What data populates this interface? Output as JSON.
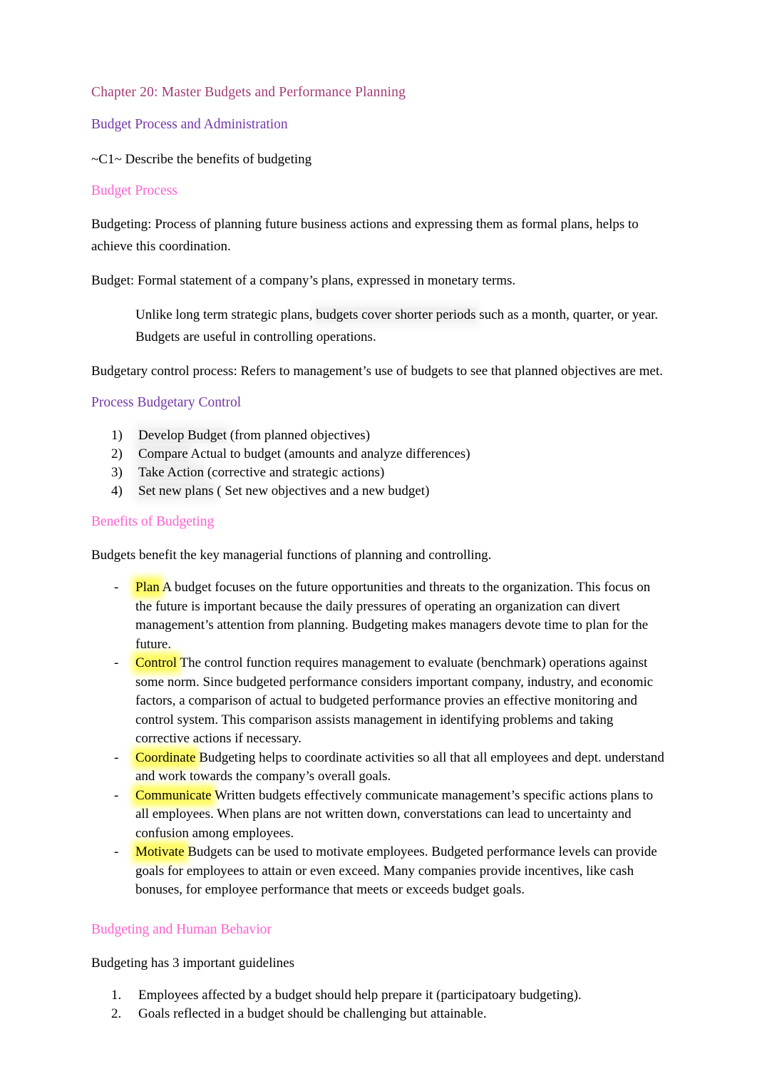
{
  "document": {
    "title": "Chapter 20: Master Budgets and Performance Planning",
    "colors": {
      "chapter_heading": "#A23A73",
      "purple_heading": "#7336A6",
      "pink_heading": "#FF5FD0",
      "body_text": "#000000",
      "highlight_yellow": "#FFFB6B",
      "highlight_gray": "#EDEDED",
      "page_background": "#FFFFFF"
    }
  },
  "sections": {
    "heading_admin": "Budget Process and Administration",
    "objective_c1": "~C1~ Describe the benefits of budgeting",
    "heading_budget_process": "Budget Process",
    "para_budgeting": "Budgeting: Process of planning future business actions and expressing them as formal plans, helps to achieve this coordination.",
    "para_budget": "Budget: Formal statement of a company’s plans, expressed in monetary terms.",
    "indent_unlike": {
      "pre": "Unlike long term strategic plans, ",
      "highlighted": "budgets cover shorter periods",
      "post": "  such as a month, quarter, or year. Budgets are useful in controlling operations."
    },
    "para_budgetary_control": "Budgetary control process:  Refers to management’s use of budgets to see that planned objectives are met.",
    "heading_process_budgetary_control": "Process Budgetary Control",
    "process_steps": [
      {
        "marker": "1)",
        "highlighted": "Develop Budget",
        "rest": " (from planned objectives)"
      },
      {
        "marker": "2)",
        "highlighted": "Compare",
        "rest": " Actual to budget (amounts and analyze differences)"
      },
      {
        "marker": "3)",
        "highlighted": "Take Action",
        "rest": " (corrective and strategic actions)"
      },
      {
        "marker": "4)",
        "highlighted": "Set new plans",
        "rest": " ( Set new objectives and a new budget)"
      }
    ],
    "heading_benefits": "Benefits of Budgeting",
    "para_benefits_intro": "Budgets benefit the key managerial functions of planning and controlling.",
    "benefits": [
      {
        "marker": "-",
        "highlighted": "Plan",
        "rest": " A budget focuses on the future opportunities and threats to the organization. This focus on the future is important because the daily pressures of operating an organization can divert management’s attention from planning. Budgeting makes managers devote time to plan for the future."
      },
      {
        "marker": "-",
        "highlighted": "Control",
        "rest": " The control function requires management to evaluate (benchmark) operations against some norm. Since budgeted performance considers important company, industry, and economic factors, a comparison of actual to budgeted performance provies an effective monitoring and control system. This comparison assists management in identifying problems and taking corrective actions if necessary."
      },
      {
        "marker": "-",
        "highlighted": "Coordinate",
        "rest": "  Budgeting helps to coordinate activities so all that all employees and dept. understand and work towards the company’s overall goals."
      },
      {
        "marker": "-",
        "highlighted": "Communicate",
        "rest": " Written budgets effectively communicate management’s specific actions plans to all employees. When plans are not written down, converstations can lead to uncertainty and confusion among employees."
      },
      {
        "marker": "-",
        "highlighted": "Motivate",
        "rest": "  Budgets can be used to motivate employees. Budgeted performance levels can provide goals for employees to attain or even exceed. Many companies provide incentives, like cash bonuses, for employee performance that meets or exceeds budget goals."
      }
    ],
    "heading_human_behavior": "Budgeting and Human Behavior",
    "para_guidelines_intro": "Budgeting has 3 important guidelines",
    "guidelines": [
      {
        "marker": "1.",
        "text": "Employees affected by a budget should help prepare it (participatoary budgeting)."
      },
      {
        "marker": "2.",
        "text": "Goals reflected in a budget should be challenging but attainable."
      }
    ]
  }
}
